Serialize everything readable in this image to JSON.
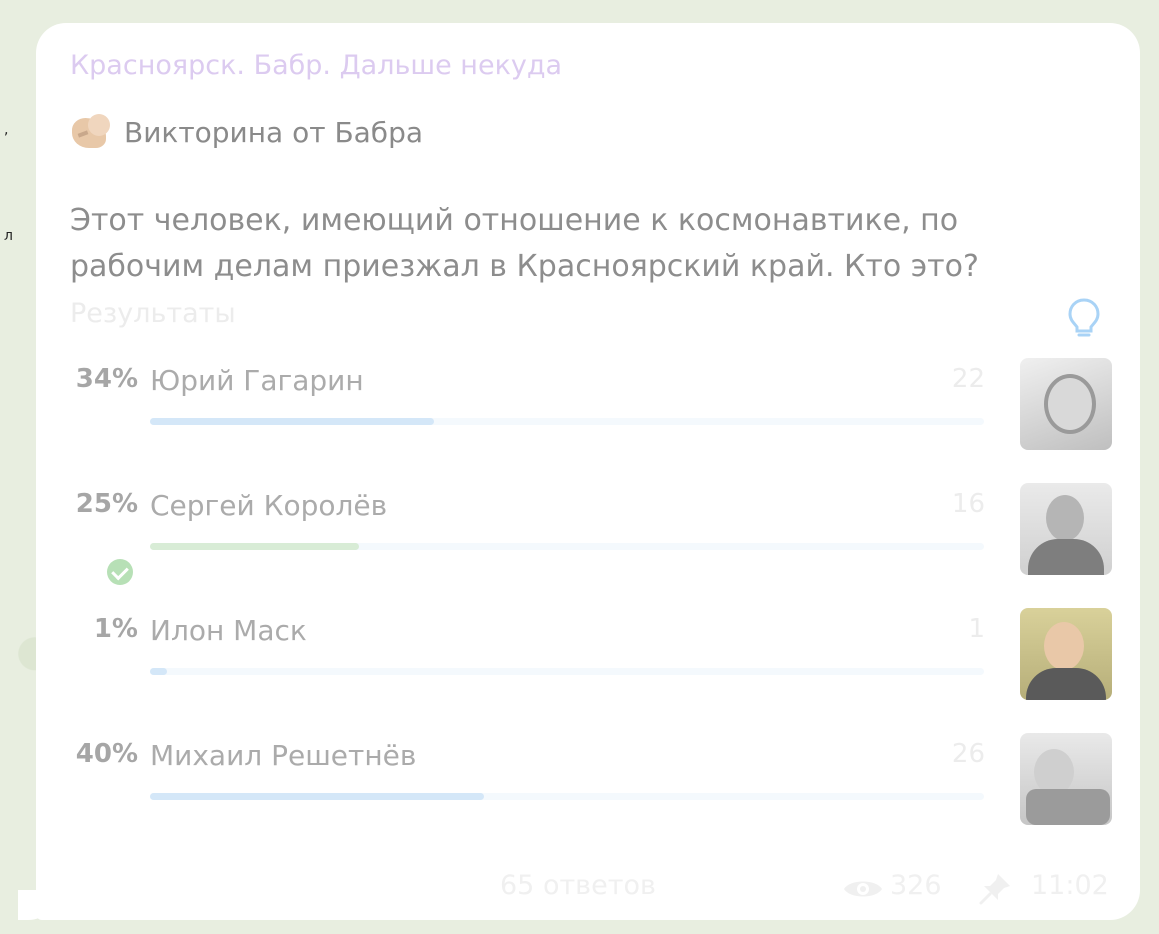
{
  "left_fragments": [
    ",",
    "л"
  ],
  "channel_name": "Красноярск. Бабр. Дальше некуда",
  "quiz_title": "Викторина от Бабра",
  "question": "Этот человек, имеющий отношение к космонавтике, по рабочим делам приезжал в Красноярский край. Кто это?",
  "results_label": "Результаты",
  "options": [
    {
      "percent": "34%",
      "name": "Юрий Гагарин",
      "count": "22",
      "fill_fraction": 0.34,
      "correct": false
    },
    {
      "percent": "25%",
      "name": "Сергей Королёв",
      "count": "16",
      "fill_fraction": 0.25,
      "correct": true
    },
    {
      "percent": "1%",
      "name": "Илон Маск",
      "count": "1",
      "fill_fraction": 0.01,
      "correct": false
    },
    {
      "percent": "40%",
      "name": "Михаил Решетнёв",
      "count": "26",
      "fill_fraction": 0.4,
      "correct": false
    }
  ],
  "footer": {
    "answers": "65 ответов",
    "views": "326",
    "time": "11:02"
  },
  "colors": {
    "bar": "#d4e7f8",
    "bar_correct": "#d8ecd6",
    "check": "#b7e0b6"
  },
  "icons": [
    "tiger-icon",
    "bulb-icon",
    "check-icon",
    "eye-icon",
    "pin-icon"
  ]
}
